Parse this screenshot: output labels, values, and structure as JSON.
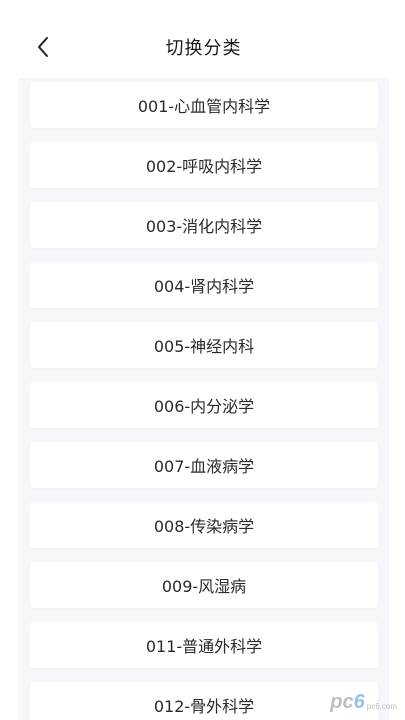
{
  "header": {
    "title": "切换分类",
    "back_icon": "chevron-left-icon"
  },
  "categories": [
    "001-心血管内科学",
    "002-呼吸内科学",
    "003-消化内科学",
    "004-肾内科学",
    "005-神经内科",
    "006-内分泌学",
    "007-血液病学",
    "008-传染病学",
    "009-风湿病",
    "011-普通外科学",
    "012-骨外科学"
  ],
  "watermark": {
    "brand_prefix": "pc",
    "brand_digit": "6",
    "sub": "pc6.com"
  },
  "colors": {
    "background": "#f6f7fb",
    "card": "#ffffff",
    "text": "#2a2a2a"
  }
}
